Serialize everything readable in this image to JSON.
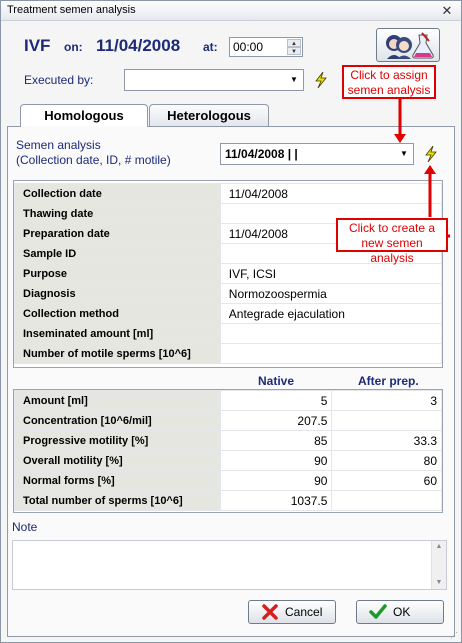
{
  "window": {
    "title": "Treatment semen analysis"
  },
  "header": {
    "procedure": "IVF",
    "on_label": "on:",
    "date": "11/04/2008",
    "at_label": "at:",
    "time": "00:00",
    "executed_by_label": "Executed by:",
    "executed_by_value": ""
  },
  "tabs": [
    {
      "label": "Homologous",
      "active": true
    },
    {
      "label": "Heterologous",
      "active": false
    }
  ],
  "semen_analysis": {
    "label_line1": "Semen analysis",
    "label_line2": "(Collection date, ID, # motile)",
    "selected": "11/04/2008 |  |"
  },
  "tooltips": {
    "assign_line1": "Click to assign",
    "assign_line2": "semen analysis",
    "create_line1": "Click to create a",
    "create_line2": "new semen analysis"
  },
  "details": [
    {
      "label": "Collection date",
      "value": "11/04/2008"
    },
    {
      "label": "Thawing date",
      "value": ""
    },
    {
      "label": "Preparation date",
      "value": "11/04/2008"
    },
    {
      "label": "Sample ID",
      "value": ""
    },
    {
      "label": "Purpose",
      "value": "IVF, ICSI"
    },
    {
      "label": "Diagnosis",
      "value": "Normozoospermia"
    },
    {
      "label": "Collection method",
      "value": "Antegrade ejaculation"
    },
    {
      "label": "Inseminated amount [ml]",
      "value": ""
    },
    {
      "label": "Number of motile sperms [10^6]",
      "value": ""
    }
  ],
  "measurements": {
    "col_native": "Native",
    "col_after": "After prep.",
    "rows": [
      {
        "label": "Amount [ml]",
        "native": "5",
        "after": "3"
      },
      {
        "label": "Concentration [10^6/mil]",
        "native": "207.5",
        "after": ""
      },
      {
        "label": "Progressive motility [%]",
        "native": "85",
        "after": "33.3"
      },
      {
        "label": "Overall motility [%]",
        "native": "90",
        "after": "80"
      },
      {
        "label": "Normal forms [%]",
        "native": "90",
        "after": "60"
      },
      {
        "label": "Total number of sperms [10^6]",
        "native": "1037.5",
        "after": ""
      }
    ]
  },
  "note": {
    "label": "Note",
    "value": ""
  },
  "buttons": {
    "cancel": "Cancel",
    "ok": "OK"
  },
  "colors": {
    "label_blue": "#1c2a78",
    "annotation_red": "#e00000",
    "grid_label_bg": "#e6e6e0"
  }
}
